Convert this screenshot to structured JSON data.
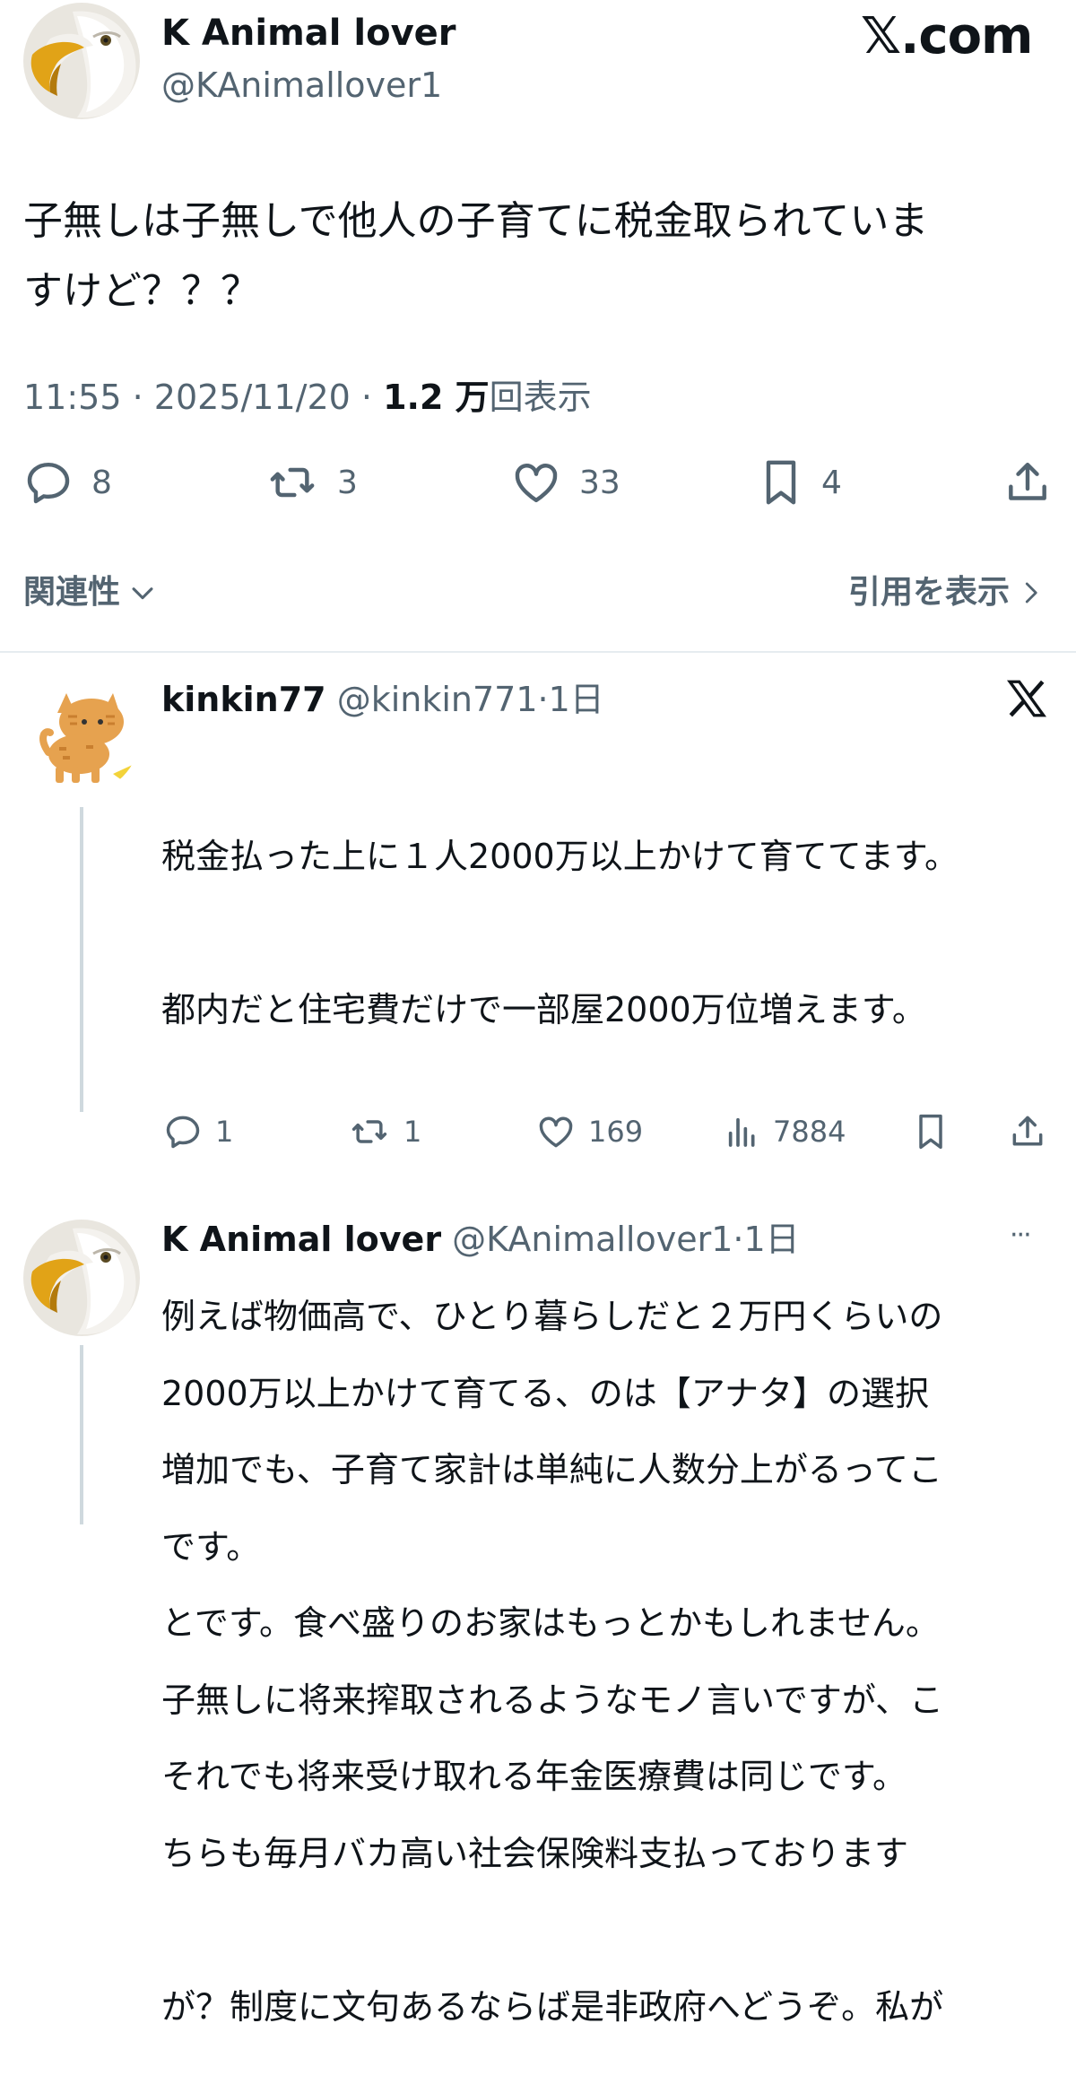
{
  "brand": {
    "logo_text": "𝕏.com"
  },
  "main_post": {
    "display_name": "K Animal lover",
    "handle": "@KAnimallover1",
    "text_line1": "子無しは子無しで他人の子育てに税金取られていま",
    "text_line2": "すけど？？？",
    "time": "11:55",
    "date": "2025/11/20",
    "views_count": "1.2 万",
    "views_label": "回表示",
    "separator": "·",
    "stats": {
      "replies": "8",
      "reposts": "3",
      "likes": "33",
      "bookmarks": "4"
    },
    "icons": [
      "reply-icon",
      "repost-icon",
      "like-icon",
      "bookmark-icon",
      "share-icon"
    ]
  },
  "sort_bar": {
    "relevance_label": "関連性",
    "quotes_label": "引用を表示"
  },
  "reply1": {
    "display_name": "kinkin77",
    "handle": "@kinkin771",
    "age": "·1日",
    "lines": [
      "税金払った上に１人2000万以上かけて育ててます。",
      "都内だと住宅費だけで一部屋2000万位増えます。",
      "",
      "例えば物価高で、ひとり暮らしだと２万円くらいの",
      "増加でも、子育て家計は単純に人数分上がるってこ",
      "とです。食べ盛りのお家はもっとかもしれません。",
      "それでも将来受け取れる年金医療費は同じです。"
    ],
    "stats": {
      "replies": "1",
      "reposts": "1",
      "likes": "169",
      "views": "7884"
    }
  },
  "reply2": {
    "display_name": "K Animal lover",
    "handle": "@KAnimallover1",
    "age": "·1日",
    "more": "···",
    "lines": [
      "2000万以上かけて育てる、のは【アナタ】の選択",
      "です。",
      "子無しに将来搾取されるようなモノ言いですが、こ",
      "ちらも毎月バカ高い社会保険料支払っております",
      "が？制度に文句あるならば是非政府へどうぞ。私が"
    ]
  },
  "colors": {
    "text": "#0f1419",
    "muted": "#536471",
    "divider": "#cfd9de"
  }
}
